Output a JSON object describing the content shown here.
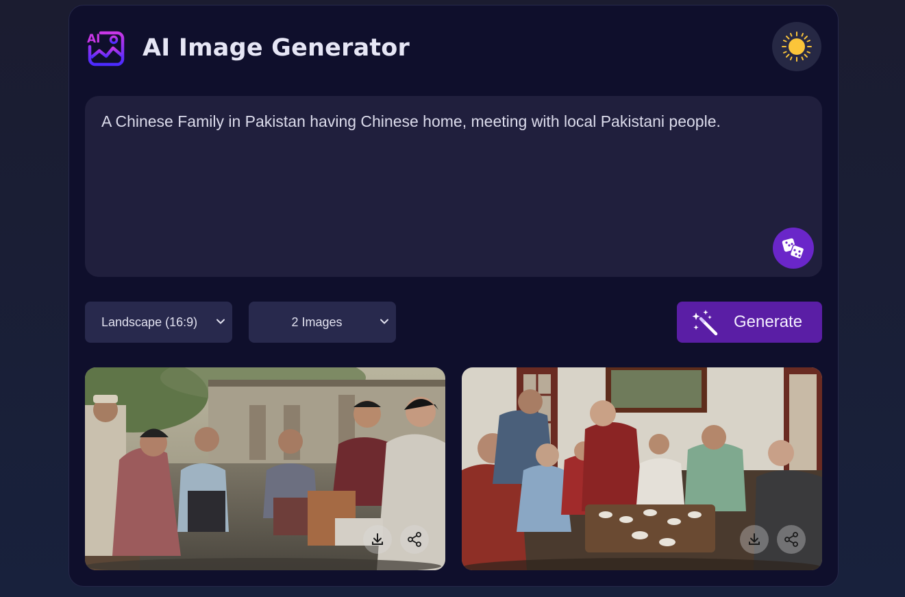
{
  "app": {
    "title": "AI Image Generator",
    "logo_icon": "ai-image-logo-icon",
    "theme_icon": "sun-icon",
    "accent_color": "#5a1ea5"
  },
  "prompt": {
    "value": "A Chinese Family in Pakistan having Chinese home, meeting with local Pakistani people.",
    "random_icon": "dice-icon"
  },
  "controls": {
    "aspect_ratio": "Landscape (16:9)",
    "image_count": "2 Images",
    "generate_label": "Generate",
    "generate_icon": "magic-wand-icon"
  },
  "gallery": [
    {
      "scene": "outdoor courtyard group conversation",
      "actions": [
        "download-icon",
        "share-icon"
      ]
    },
    {
      "scene": "indoor family gathering around low table",
      "actions": [
        "download-icon",
        "share-icon"
      ]
    }
  ]
}
